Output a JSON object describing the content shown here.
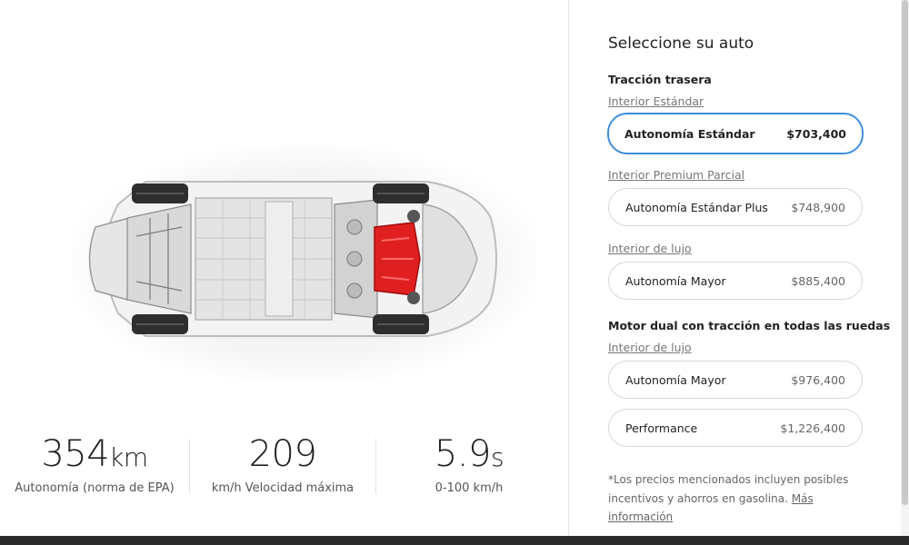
{
  "stats": [
    {
      "value": "354",
      "unit": "km",
      "label": "Autonomía (norma de EPA)"
    },
    {
      "value": "209",
      "unit": "",
      "label": "km/h Velocidad máxima"
    },
    {
      "value": "5.9",
      "unit": "s",
      "label": "0-100 km/h"
    }
  ],
  "panel": {
    "title": "Seleccione su auto",
    "groups": [
      {
        "title": "Tracción trasera",
        "sections": [
          {
            "interior": "Interior Estándar",
            "options": [
              {
                "name": "Autonomía Estándar",
                "price": "$703,400",
                "selected": true
              }
            ]
          },
          {
            "interior": "Interior Premium Parcial",
            "options": [
              {
                "name": "Autonomía Estándar Plus",
                "price": "$748,900"
              }
            ]
          },
          {
            "interior": "Interior de lujo",
            "options": [
              {
                "name": "Autonomía Mayor",
                "price": "$885,400"
              }
            ]
          }
        ]
      },
      {
        "title": "Motor dual con tracción en todas las ruedas",
        "sections": [
          {
            "interior": "Interior de lujo",
            "options": [
              {
                "name": "Autonomía Mayor",
                "price": "$976,400"
              },
              {
                "name": "Performance",
                "price": "$1,226,400"
              }
            ]
          }
        ]
      }
    ],
    "note": "*Los precios mencionados incluyen posibles incentivos y ahorros en gasolina.",
    "note_link": "Más información"
  },
  "colors": {
    "selected_border": "#3e8ddd",
    "motor": "#e02020",
    "footer": "#2b2b2b"
  }
}
